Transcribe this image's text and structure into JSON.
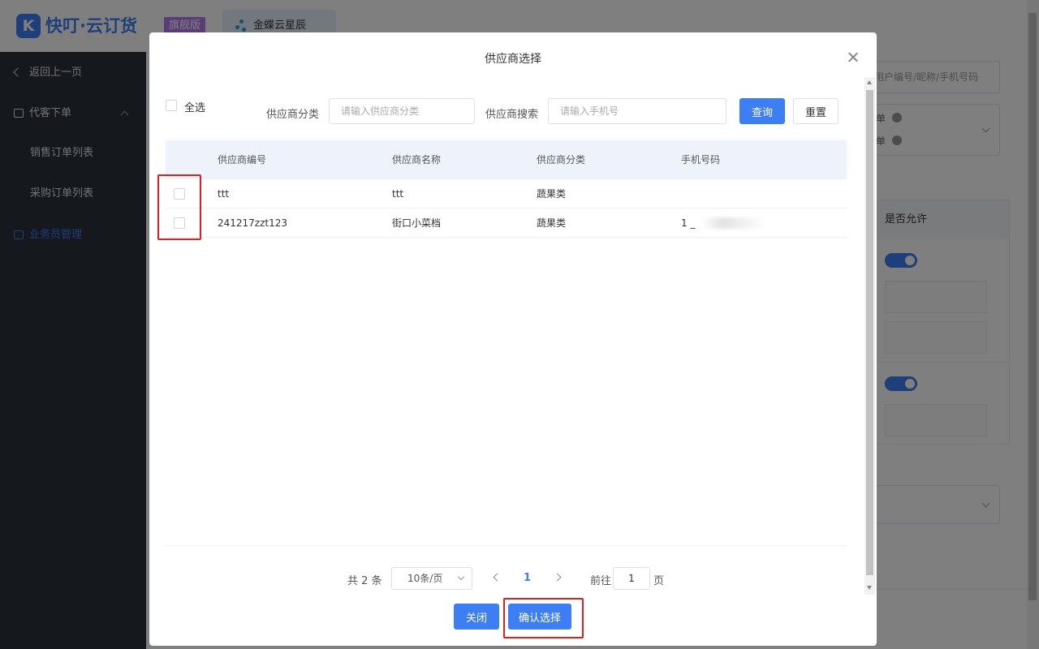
{
  "header": {
    "logo_letter": "K",
    "brand": "快叮·云订货",
    "edition": "旗舰版",
    "partner_label": "金蝶云星辰"
  },
  "sidebar": {
    "back": "返回上一页",
    "group": "代客下单",
    "items": [
      "销售订单列表",
      "采购订单列表"
    ],
    "active": "业务员管理"
  },
  "background": {
    "search_placeholder": "用户编号/昵称/手机号码",
    "select_option_suffix": "单",
    "table_header": "是否允许"
  },
  "dialog": {
    "title": "供应商选择",
    "select_all": "全选",
    "filters": {
      "category_label": "供应商分类",
      "category_placeholder": "请输入供应商分类",
      "search_label": "供应商搜索",
      "search_placeholder": "请输入手机号",
      "query_button": "查询",
      "reset_button": "重置"
    },
    "columns": [
      "供应商编号",
      "供应商名称",
      "供应商分类",
      "手机号码"
    ],
    "rows": [
      {
        "code": "ttt",
        "name": "ttt",
        "category": "蔬果类",
        "phone": ""
      },
      {
        "code": "241217zzt123",
        "name": "街口小菜档",
        "category": "蔬果类",
        "phone": "1         _"
      }
    ],
    "pagination": {
      "total": "共 2 条",
      "page_size": "10条/页",
      "current": "1",
      "goto_label": "前往",
      "goto_value": "1",
      "page_suffix": "页"
    },
    "close_button": "关闭",
    "confirm_button": "确认选择"
  },
  "colors": {
    "accent": "#3d7ef4",
    "sidebar_bg": "#2b303b",
    "highlight_red": "#e02020"
  }
}
